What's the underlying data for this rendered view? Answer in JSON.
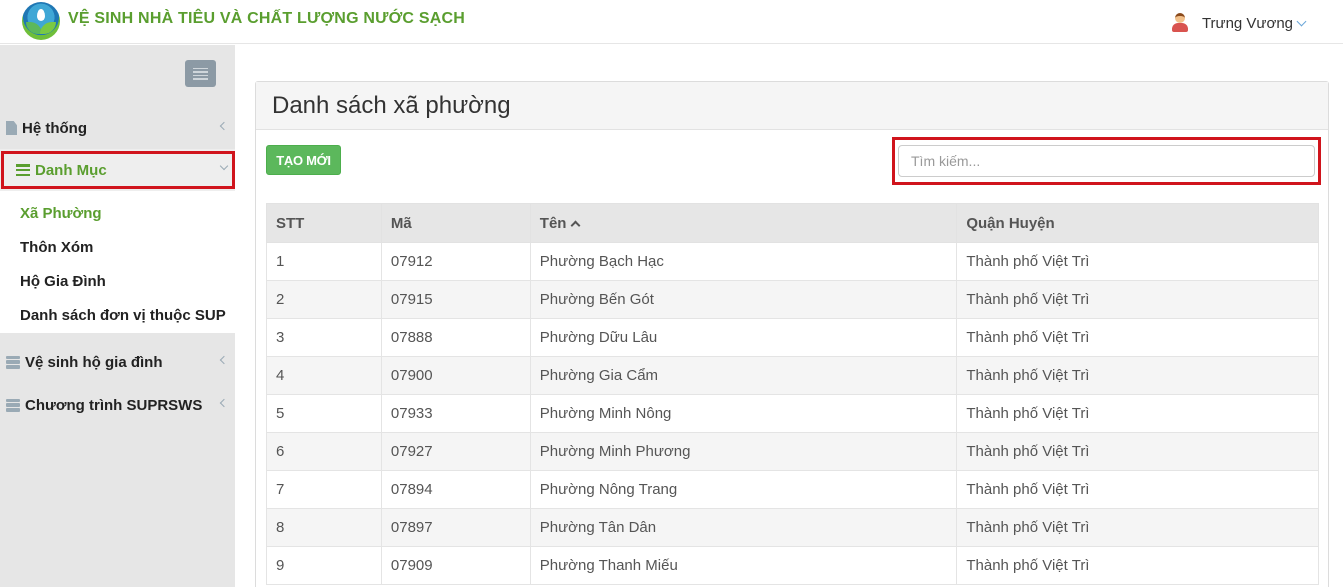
{
  "header": {
    "app_title": "VỆ SINH NHÀ TIÊU VÀ CHẤT LƯỢNG NƯỚC SẠCH",
    "user_name": "Trưng Vương"
  },
  "sidebar": {
    "items": [
      {
        "label": "Hệ thống",
        "icon": "file-icon"
      },
      {
        "label": "Danh Mục",
        "icon": "list-icon",
        "expanded": true
      },
      {
        "label": "Vệ sinh hộ gia đình",
        "icon": "server-icon"
      },
      {
        "label": "Chương trình SUPRSWS",
        "icon": "server-icon"
      }
    ],
    "submenu": [
      {
        "label": "Xã Phường",
        "active": true
      },
      {
        "label": "Thôn Xóm"
      },
      {
        "label": "Hộ Gia Đình"
      },
      {
        "label": "Danh sách đơn vị thuộc SUP"
      }
    ]
  },
  "main": {
    "title": "Danh sách xã phường",
    "create_label": "TẠO MỚI",
    "search_placeholder": "Tìm kiếm...",
    "table": {
      "headers": [
        "STT",
        "Mã",
        "Tên",
        "Quận Huyện"
      ],
      "sort_column": "Tên",
      "rows": [
        [
          "1",
          "07912",
          "Phường Bạch Hạc",
          "Thành phố Việt Trì"
        ],
        [
          "2",
          "07915",
          "Phường Bến Gót",
          "Thành phố Việt Trì"
        ],
        [
          "3",
          "07888",
          "Phường Dữu Lâu",
          "Thành phố Việt Trì"
        ],
        [
          "4",
          "07900",
          "Phường Gia Cẩm",
          "Thành phố Việt Trì"
        ],
        [
          "5",
          "07933",
          "Phường Minh Nông",
          "Thành phố Việt Trì"
        ],
        [
          "6",
          "07927",
          "Phường Minh Phương",
          "Thành phố Việt Trì"
        ],
        [
          "7",
          "07894",
          "Phường Nông Trang",
          "Thành phố Việt Trì"
        ],
        [
          "8",
          "07897",
          "Phường Tân Dân",
          "Thành phố Việt Trì"
        ],
        [
          "9",
          "07909",
          "Phường Thanh Miếu",
          "Thành phố Việt Trì"
        ]
      ]
    }
  },
  "colors": {
    "brand_green": "#5a9e2f",
    "button_green": "#5cb85c",
    "highlight_red": "#d0141c"
  }
}
